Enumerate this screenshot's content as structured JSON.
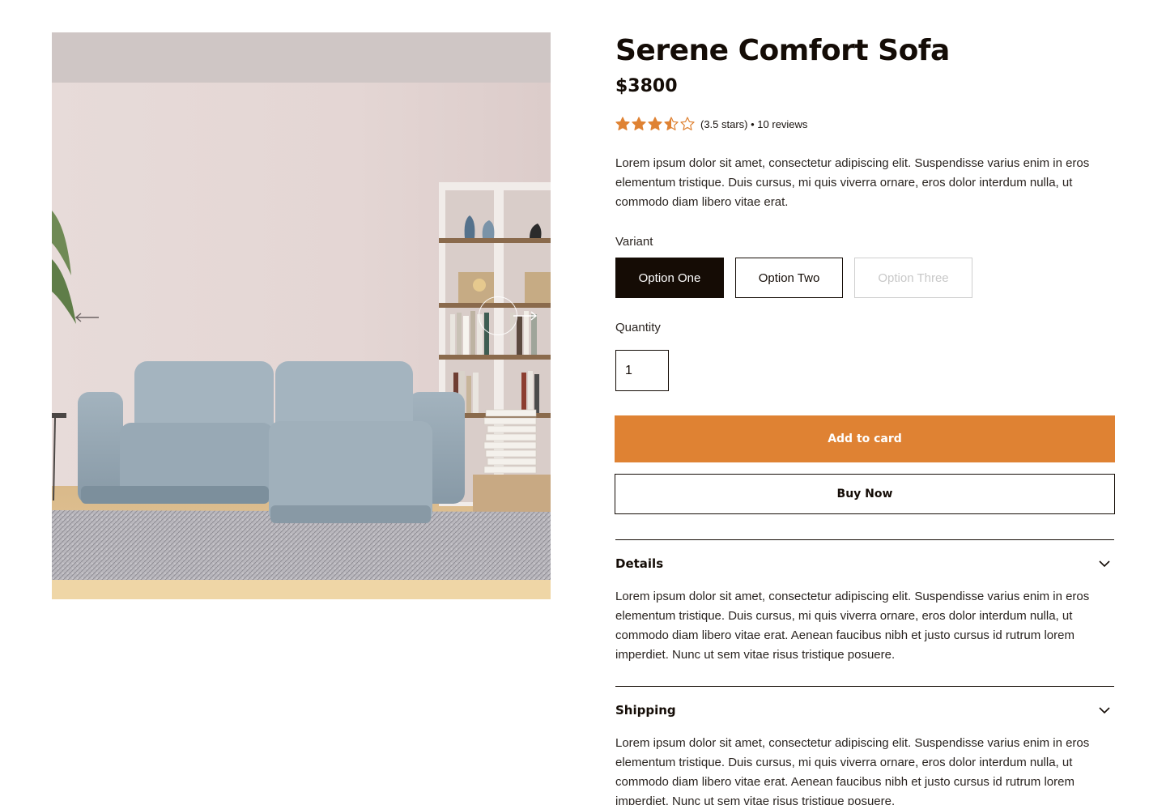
{
  "product": {
    "title": "Serene Comfort Sofa",
    "price": "$3800",
    "rating": {
      "value": 3.5,
      "max": 5,
      "text": "(3.5 stars) • 10 reviews"
    },
    "description": "Lorem ipsum dolor sit amet, consectetur adipiscing elit. Suspendisse varius enim in eros elementum tristique. Duis cursus, mi quis viverra ornare, eros dolor interdum nulla, ut commodo diam libero vitae erat."
  },
  "variant": {
    "label": "Variant",
    "options": [
      {
        "label": "Option One",
        "state": "selected"
      },
      {
        "label": "Option Two",
        "state": "default"
      },
      {
        "label": "Option Three",
        "state": "disabled"
      }
    ]
  },
  "quantity": {
    "label": "Quantity",
    "value": "1"
  },
  "actions": {
    "add_to_cart": "Add to card",
    "buy_now": "Buy Now"
  },
  "accordion": [
    {
      "title": "Details",
      "body": "Lorem ipsum dolor sit amet, consectetur adipiscing elit. Suspendisse varius enim in eros elementum tristique. Duis cursus, mi quis viverra ornare, eros dolor interdum nulla, ut commodo diam libero vitae erat. Aenean faucibus nibh et justo cursus id rutrum lorem imperdiet. Nunc ut sem vitae risus tristique posuere."
    },
    {
      "title": "Shipping",
      "body": "Lorem ipsum dolor sit amet, consectetur adipiscing elit. Suspendisse varius enim in eros elementum tristique. Duis cursus, mi quis viverra ornare, eros dolor interdum nulla, ut commodo diam libero vitae erat. Aenean faucibus nibh et justo cursus id rutrum lorem imperdiet. Nunc ut sem vitae risus tristique posuere."
    }
  ],
  "icons": {
    "star": "star-icon",
    "prev": "arrow-left-icon",
    "next": "arrow-right-icon",
    "chevron": "chevron-down-icon"
  },
  "colors": {
    "accent": "#df8233",
    "ink": "#140c06",
    "star": "#df8233",
    "disabled": "#c8c8c8"
  }
}
